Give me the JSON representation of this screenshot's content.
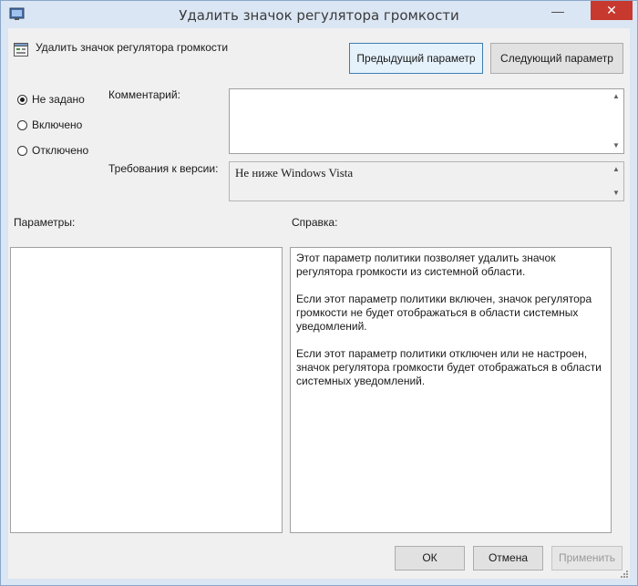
{
  "window": {
    "title": "Удалить значок регулятора громкости",
    "close_glyph": "✕",
    "minimize_glyph": "—"
  },
  "policy": {
    "name": "Удалить значок регулятора громкости"
  },
  "nav": {
    "prev_label": "Предыдущий параметр",
    "next_label": "Следующий параметр"
  },
  "state": {
    "options": [
      {
        "label": "Не задано",
        "selected": true
      },
      {
        "label": "Включено",
        "selected": false
      },
      {
        "label": "Отключено",
        "selected": false
      }
    ]
  },
  "comment": {
    "label": "Комментарий:",
    "value": ""
  },
  "requirements": {
    "label": "Требования к версии:",
    "value": "Не ниже Windows Vista"
  },
  "params": {
    "label": "Параметры:"
  },
  "help": {
    "label": "Справка:",
    "paragraphs": [
      "Этот параметр политики позволяет удалить значок регулятора громкости из системной области.",
      "Если этот параметр политики включен, значок регулятора громкости не будет отображаться в области системных уведомлений.",
      "Если этот параметр политики отключен или не настроен, значок регулятора громкости будет отображаться в области системных уведомлений."
    ]
  },
  "footer": {
    "ok_label": "ОК",
    "cancel_label": "Отмена",
    "apply_label": "Применить"
  },
  "colors": {
    "close_red": "#c7392e",
    "window_frame": "#dbe6f4",
    "client_bg": "#f0f0f0"
  }
}
